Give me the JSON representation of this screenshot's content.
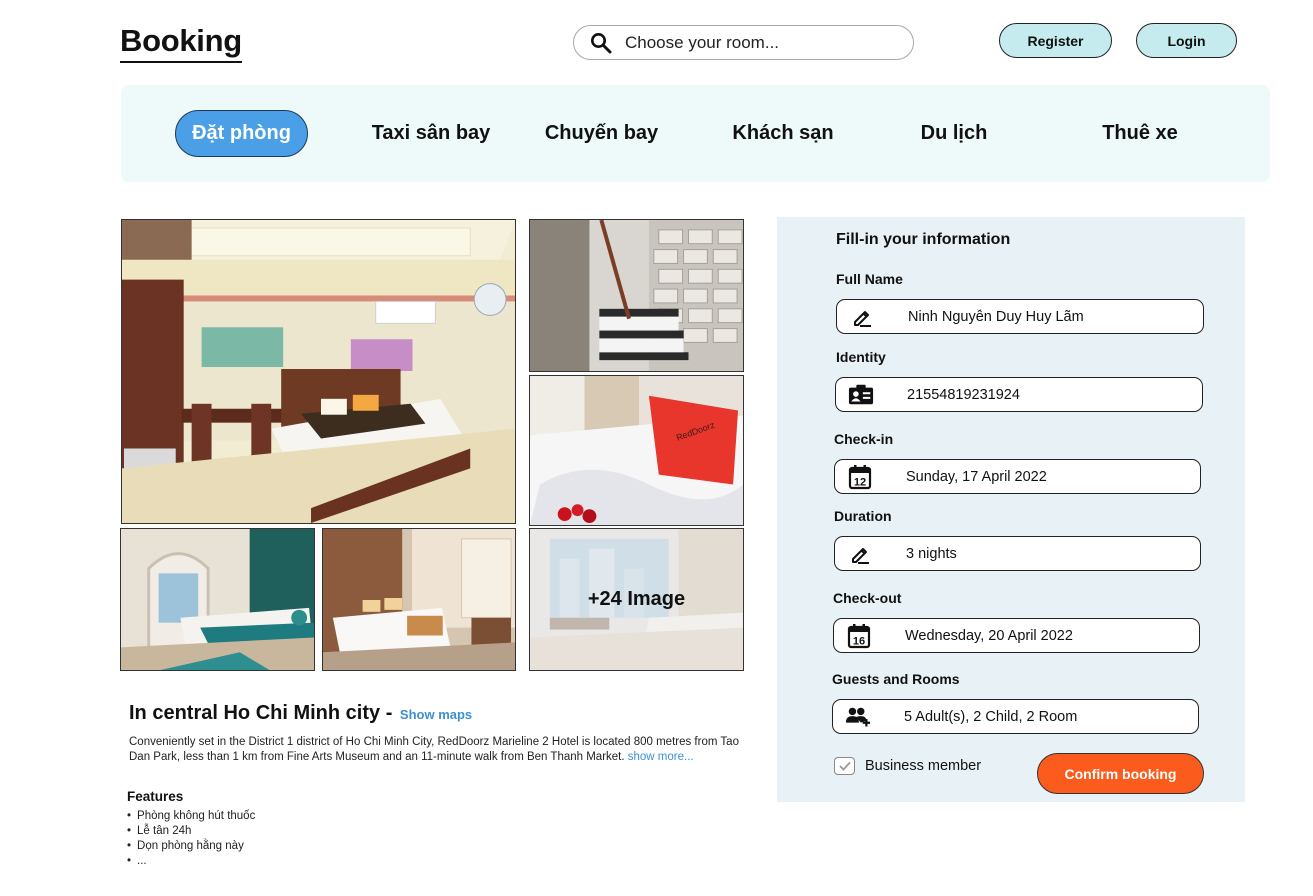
{
  "header": {
    "brand": "Booking",
    "search_placeholder": "Choose your room...",
    "register_label": "Register",
    "login_label": "Login"
  },
  "nav": {
    "tabs": [
      {
        "label": "Đặt phòng",
        "active": true
      },
      {
        "label": "Taxi sân bay",
        "active": false
      },
      {
        "label": "Chuyến bay",
        "active": false
      },
      {
        "label": "Khách sạn",
        "active": false
      },
      {
        "label": "Du lịch",
        "active": false
      },
      {
        "label": "Thuê xe",
        "active": false
      }
    ]
  },
  "gallery": {
    "more_label": "+24 Image",
    "photo_badge": "RedDoorz"
  },
  "description": {
    "title": "In central Ho Chi Minh city -",
    "maps_link": "Show maps",
    "text": "Conveniently set in the District 1 district of Ho Chi Minh City, RedDoorz Marieline 2 Hotel is located 800 metres from Tao Dan Park, less than 1 km from Fine Arts Museum and an 11-minute walk from Ben Thanh Market.",
    "show_more": "show more...",
    "features_title": "Features",
    "features": [
      "Phòng không hút thuốc",
      "Lễ  tân 24h",
      "Dọn phòng hằng này",
      "..."
    ]
  },
  "form": {
    "title": "Fill-in your information",
    "fields": {
      "full_name": {
        "label": "Full Name",
        "value": "Ninh Nguyễn Duy Huy Lãm",
        "icon": "pencil-icon"
      },
      "identity": {
        "label": "Identity",
        "value": "21554819231924",
        "icon": "id-card-icon"
      },
      "check_in": {
        "label": "Check-in",
        "value": "Sunday, 17 April 2022",
        "icon": "calendar-icon",
        "icon_day": "12"
      },
      "duration": {
        "label": "Duration",
        "value": "3 nights",
        "icon": "pencil-icon"
      },
      "check_out": {
        "label": "Check-out",
        "value": "Wednesday, 20 April 2022",
        "icon": "calendar-icon",
        "icon_day": "16"
      },
      "guests": {
        "label": "Guests and Rooms",
        "value": "5 Adult(s), 2 Child, 2 Room",
        "icon": "add-group-icon"
      }
    },
    "business_member_label": "Business member",
    "business_member_checked": true,
    "confirm_label": "Confirm booking"
  },
  "colors": {
    "accent_blue": "#4b9fe6",
    "button_teal": "#c5ebee",
    "nav_bg": "#eef9f9",
    "panel_bg": "#e8f1f5",
    "confirm_orange": "#fb5c1d",
    "link_blue": "#3d8fd1"
  }
}
